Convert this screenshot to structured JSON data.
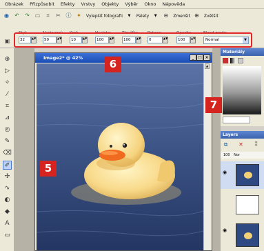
{
  "menu": {
    "items": [
      "Obrázek",
      "Přizpůsobit",
      "Efekty",
      "Vrstvy",
      "Objekty",
      "Výběr",
      "Okno",
      "Nápověda"
    ]
  },
  "toolbar": {
    "enhance_label": "Vylepšit fotografii",
    "palettes_label": "Palety",
    "zoom_out_label": "Zmenšit",
    "zoom_in_label": "Zvětšit"
  },
  "options": {
    "labels": [
      "Styl:",
      "Nastavení:",
      "Krok:",
      "Hustota:",
      "Tloušťka:",
      "Rotace:",
      "Opacita:",
      "Blend mode:"
    ],
    "values": [
      "32",
      "50",
      "10",
      "100",
      "100",
      "0",
      "100"
    ],
    "blend_mode": "Normal"
  },
  "image_window": {
    "title": "Image2* @ 42%",
    "min": "_",
    "max": "□",
    "close": "×"
  },
  "materials_panel": {
    "title": "Materiály"
  },
  "layers_panel": {
    "title": "Layers",
    "opacity_value": "100",
    "mode_value": "Nor"
  },
  "callouts": {
    "left": "5",
    "top": "6",
    "right": "7"
  },
  "colors": {
    "callout": "#d5241f",
    "highlight": "#e3262a",
    "titlebar": "#1b4fb4"
  }
}
